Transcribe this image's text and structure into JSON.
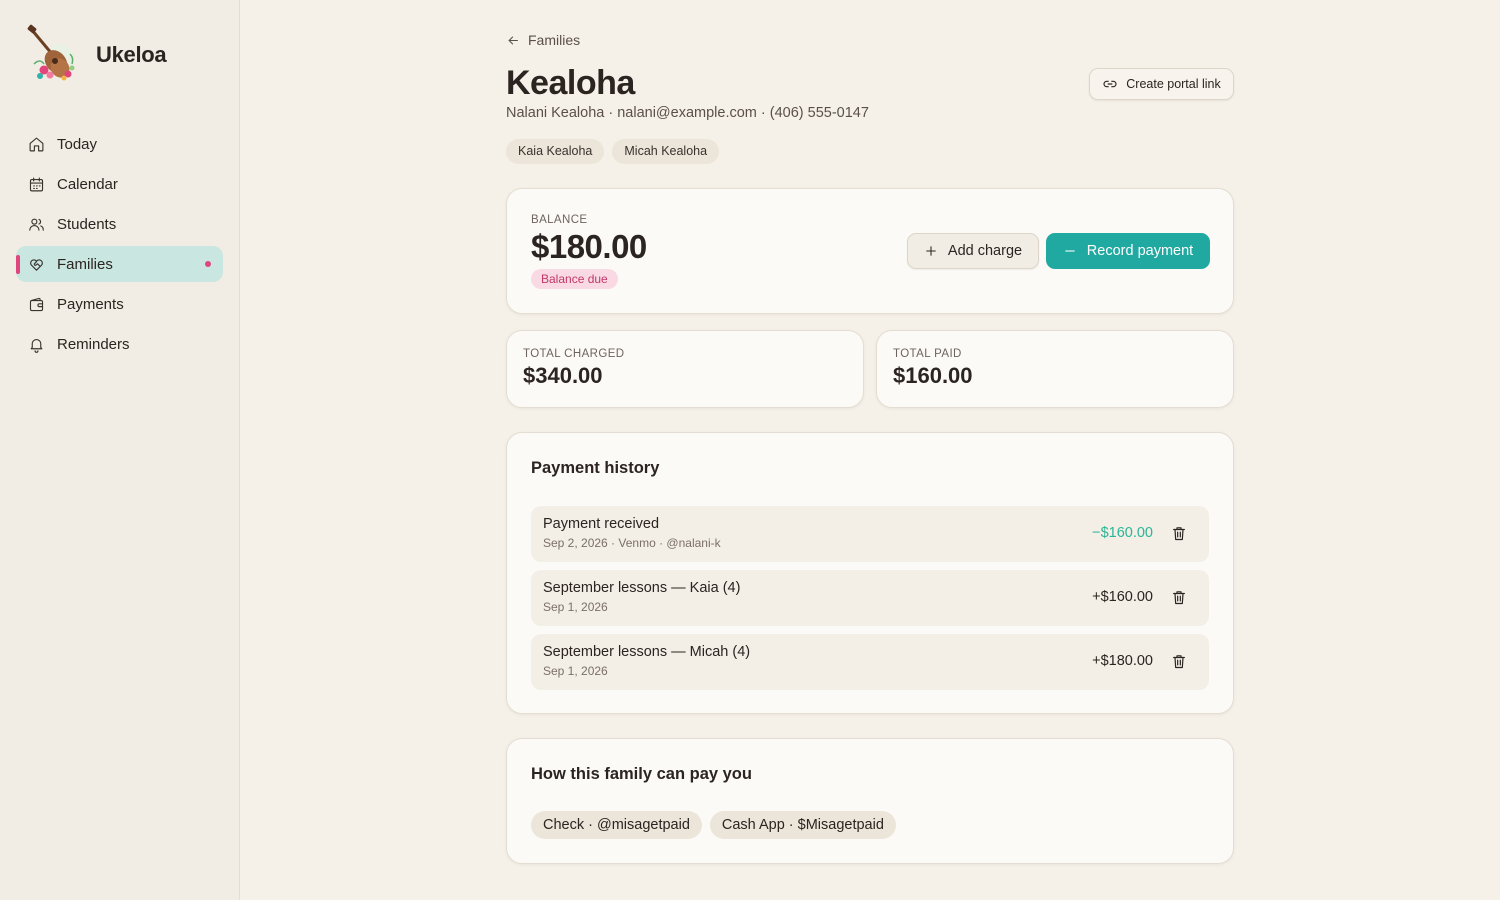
{
  "app": {
    "name": "Ukeloa"
  },
  "sidebar": {
    "items": [
      {
        "label": "Today",
        "icon": "home-icon"
      },
      {
        "label": "Calendar",
        "icon": "calendar-icon"
      },
      {
        "label": "Students",
        "icon": "users-icon"
      },
      {
        "label": "Families",
        "icon": "heart-handshake-icon",
        "active": true
      },
      {
        "label": "Payments",
        "icon": "wallet-icon"
      },
      {
        "label": "Reminders",
        "icon": "bell-icon"
      }
    ]
  },
  "header": {
    "back_label": "Families",
    "title": "Kealoha",
    "contact": "Nalani Kealoha · nalani@example.com · (406) 555-0147",
    "students": [
      "Kaia Kealoha",
      "Micah Kealoha"
    ],
    "portal_button": "Create portal link"
  },
  "balance": {
    "label": "BALANCE",
    "amount": "$180.00",
    "status": "Balance due",
    "add_charge_label": "Add charge",
    "record_payment_label": "Record payment"
  },
  "stats": {
    "charged_label": "TOTAL CHARGED",
    "charged_value": "$340.00",
    "paid_label": "TOTAL PAID",
    "paid_value": "$160.00"
  },
  "history": {
    "title": "Payment history",
    "entries": [
      {
        "title": "Payment received",
        "subtitle": "Sep 2, 2026 · Venmo · @nalani-k",
        "amount": "−$160.00",
        "type": "payment"
      },
      {
        "title": "September lessons — Kaia (4)",
        "subtitle": "Sep 1, 2026",
        "amount": "+$160.00",
        "type": "charge"
      },
      {
        "title": "September lessons — Micah (4)",
        "subtitle": "Sep 1, 2026",
        "amount": "+$180.00",
        "type": "charge"
      }
    ]
  },
  "pay_methods": {
    "title": "How this family can pay you",
    "methods": [
      "Check · @misagetpaid",
      "Cash App · $Misagetpaid"
    ]
  },
  "colors": {
    "accent_teal": "#1fa9a0",
    "active_nav": "#c9e6e1",
    "pink_indicator": "#e0457b",
    "payment_green": "#2bb596",
    "background": "#f5f0e8"
  }
}
